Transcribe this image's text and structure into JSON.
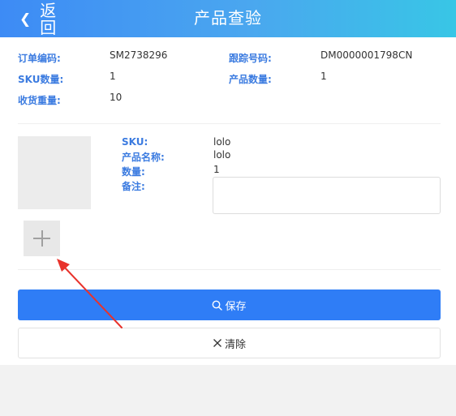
{
  "header": {
    "back_label": "返回",
    "title": "产品查验"
  },
  "order_info": {
    "order_no_label": "订单编码:",
    "order_no": "SM2738296",
    "tracking_label": "跟踪号码:",
    "tracking_no": "DM0000001798CN",
    "sku_count_label": "SKU数量:",
    "sku_count": "1",
    "product_count_label": "产品数量:",
    "product_count": "1",
    "weight_label": "收货重量:",
    "weight": "10"
  },
  "product": {
    "sku_label": "SKU:",
    "sku": "lolo",
    "name_label": "产品名称:",
    "name": "lolo",
    "qty_label": "数量:",
    "qty": "1",
    "note_label": "备注:",
    "note_value": ""
  },
  "actions": {
    "save_label": "保存",
    "clear_label": "清除"
  },
  "icons": {
    "back": "chevron-left-icon",
    "upload": "plus-icon",
    "save": "search-icon",
    "clear": "close-icon"
  },
  "colors": {
    "header_start": "#3d8bf5",
    "header_end": "#38c6e6",
    "label_blue": "#3b7be0",
    "primary_button": "#2f7df6",
    "annotation_arrow": "#e8322b"
  }
}
